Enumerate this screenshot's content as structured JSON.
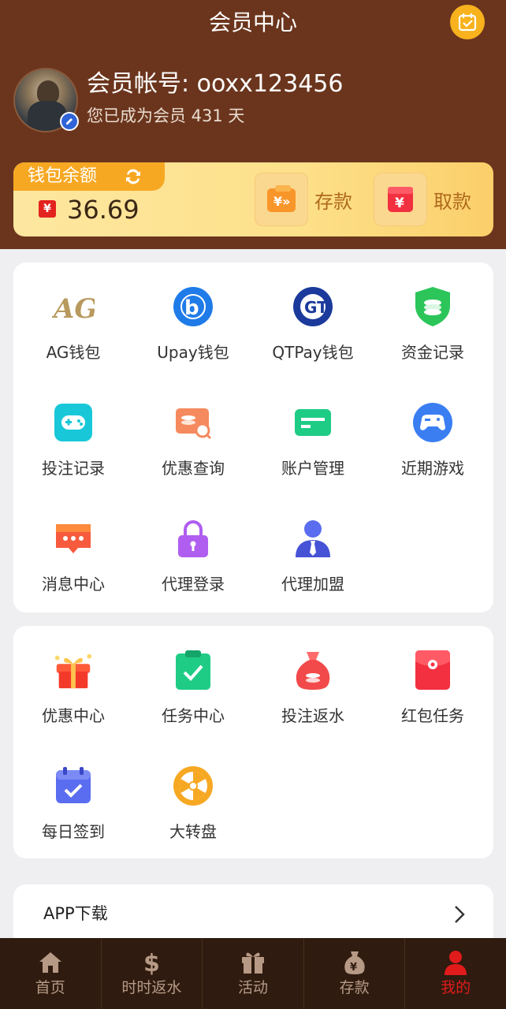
{
  "header": {
    "title": "会员中心",
    "account": "会员帐号: ooxx123456",
    "member_days": "您已成为会员 431 天"
  },
  "wallet": {
    "label": "钱包余额",
    "currency_symbol": "¥",
    "balance": "36.69",
    "deposit_label": "存款",
    "withdraw_label": "取款"
  },
  "menu1": [
    {
      "label": "AG钱包",
      "icon": "ag-logo-icon"
    },
    {
      "label": "Upay钱包",
      "icon": "upay-logo-icon"
    },
    {
      "label": "QTPay钱包",
      "icon": "qtpay-logo-icon"
    },
    {
      "label": "资金记录",
      "icon": "shield-coins-icon"
    },
    {
      "label": "投注记录",
      "icon": "gamepad-icon"
    },
    {
      "label": "优惠查询",
      "icon": "coupon-search-icon"
    },
    {
      "label": "账户管理",
      "icon": "card-icon"
    },
    {
      "label": "近期游戏",
      "icon": "controller-icon"
    },
    {
      "label": "消息中心",
      "icon": "message-icon"
    },
    {
      "label": "代理登录",
      "icon": "lock-icon"
    },
    {
      "label": "代理加盟",
      "icon": "agent-person-icon"
    }
  ],
  "menu2": [
    {
      "label": "优惠中心",
      "icon": "gift-box-icon"
    },
    {
      "label": "任务中心",
      "icon": "clipboard-check-icon"
    },
    {
      "label": "投注返水",
      "icon": "money-bag-icon"
    },
    {
      "label": "红包任务",
      "icon": "red-envelope-icon"
    },
    {
      "label": "每日签到",
      "icon": "calendar-check-icon"
    },
    {
      "label": "大转盘",
      "icon": "wheel-icon"
    }
  ],
  "app_download": {
    "label": "APP下载"
  },
  "tabbar": [
    {
      "label": "首页",
      "icon": "home-icon"
    },
    {
      "label": "时时返水",
      "icon": "dollar-icon"
    },
    {
      "label": "活动",
      "icon": "gift-icon"
    },
    {
      "label": "存款",
      "icon": "yen-bag-icon"
    },
    {
      "label": "我的",
      "icon": "user-icon"
    }
  ],
  "colors": {
    "header_bg": "#6b351d",
    "accent_orange": "#f7a823",
    "active_tab": "#e11b1b",
    "tabbar_bg": "#2f1b0f"
  }
}
